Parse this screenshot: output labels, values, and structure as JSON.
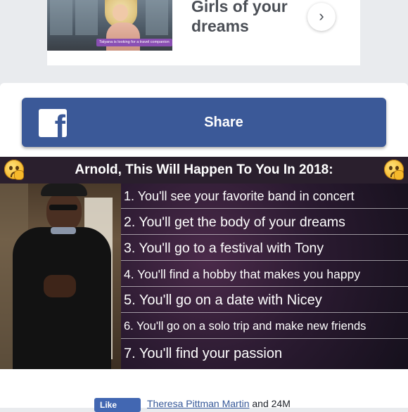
{
  "ad": {
    "title": "Girls of your dreams",
    "caption": "Tatyana is looking for a travel companion",
    "arrow_glyph": "›",
    "arrow_icon": "chevron-right-icon"
  },
  "share": {
    "label": "Share",
    "icon": "facebook-icon",
    "icon_glyph": "f",
    "color": "#3b5998"
  },
  "banner": {
    "title": "Arnold, This Will Happen To You In 2018:",
    "emoji_icon": "thinking-face-icon",
    "items": [
      "1. You'll see your favorite band in concert",
      "2. You'll get the body of your dreams",
      "3. You'll go to a festival with Tony",
      "4. You'll find a hobby that makes you happy",
      "5. You'll go on a date with Nicey",
      "6. You'll go on a solo trip and make new friends",
      "7. You'll find your passion"
    ]
  },
  "likes": {
    "button_label": "Like",
    "name": "Theresa Pittman Martin",
    "suffix": " and 24M"
  }
}
